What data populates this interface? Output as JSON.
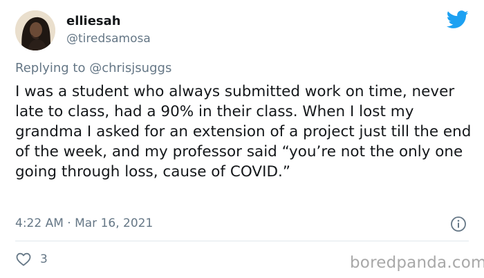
{
  "author": {
    "display_name": "elliesah",
    "handle": "@tiredsamosa",
    "avatar": "profile-photo"
  },
  "reply": {
    "prefix": "Replying to",
    "mention": "@chrisjsuggs"
  },
  "tweet": {
    "text": "I was a student who always submitted work on time, never late to class, had a 90% in their class. When I lost my grandma I asked for an extension of a project just till the end of the week, and my professor said “you’re not the only one going through loss, cause of COVID.”",
    "timestamp": "4:22 AM · Mar 16, 2021"
  },
  "engagement": {
    "like_count": "3"
  },
  "icons": {
    "brand": "twitter-bird-icon",
    "info": "info-icon",
    "like": "heart-icon"
  },
  "colors": {
    "twitter_blue": "#1da1f2",
    "text_primary": "#14171a",
    "text_secondary": "#657786",
    "divider": "#e1e8ed",
    "watermark": "#a8a8a8"
  },
  "watermark": "boredpanda.com"
}
